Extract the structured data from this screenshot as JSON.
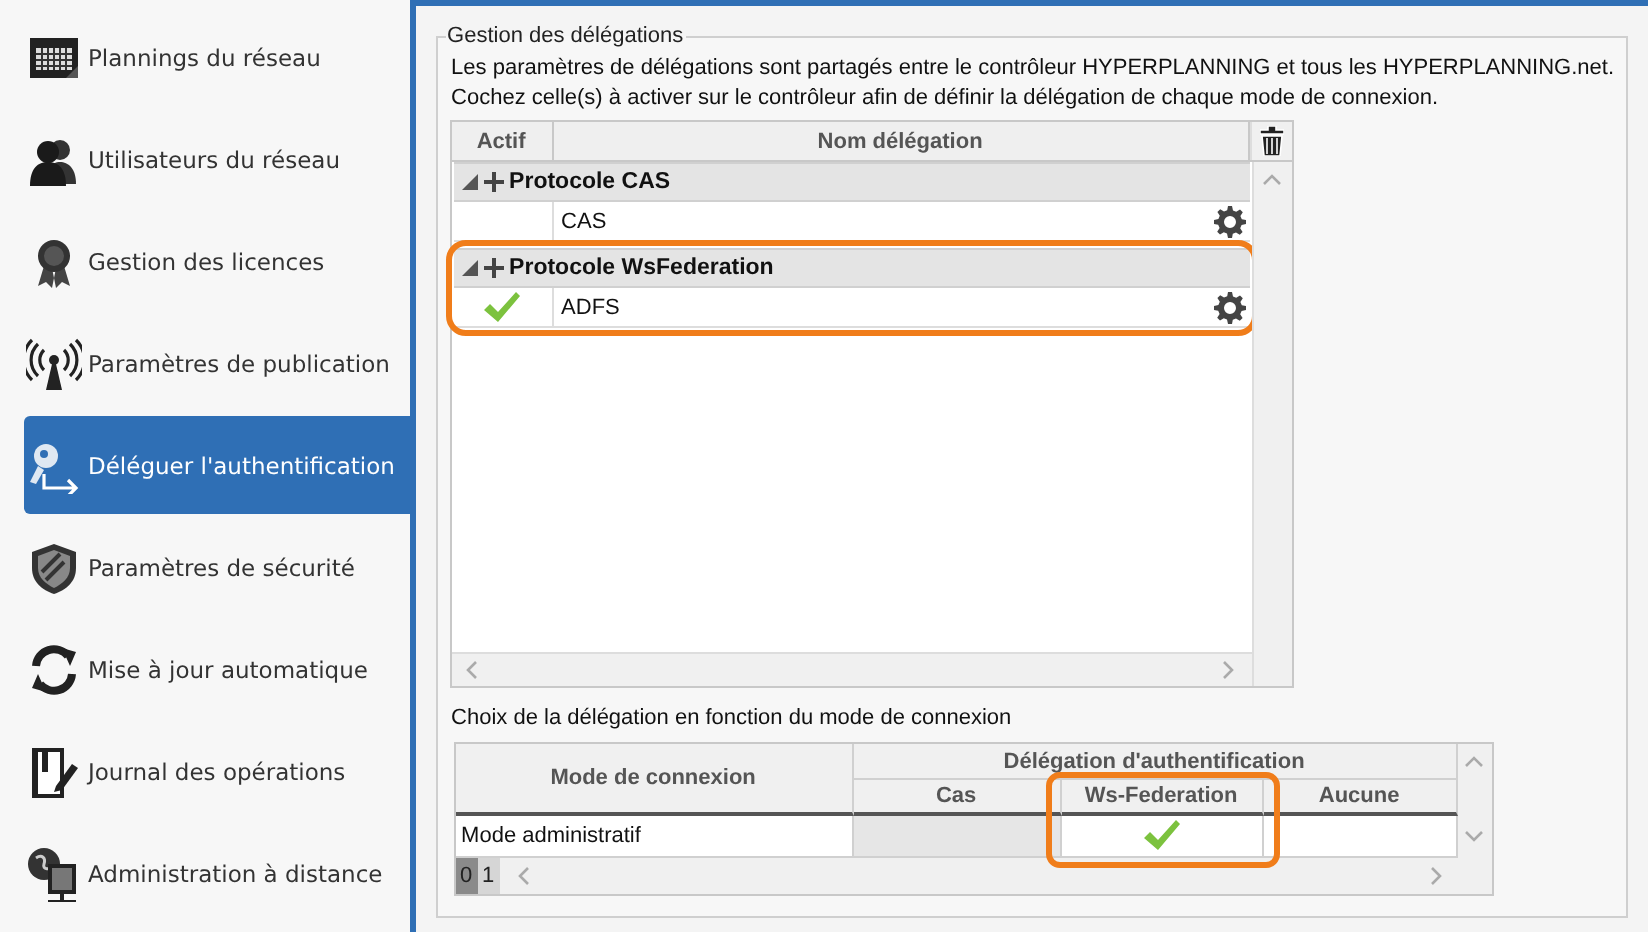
{
  "sidebar": {
    "items": [
      {
        "label": "Plannings du réseau",
        "selected": false
      },
      {
        "label": "Utilisateurs du réseau",
        "selected": false
      },
      {
        "label": "Gestion des licences",
        "selected": false
      },
      {
        "label": "Paramètres de publication",
        "selected": false
      },
      {
        "label": "Déléguer l'authentification",
        "selected": true
      },
      {
        "label": "Paramètres de sécurité",
        "selected": false
      },
      {
        "label": "Mise à jour automatique",
        "selected": false
      },
      {
        "label": "Journal des opérations",
        "selected": false
      },
      {
        "label": "Administration à distance",
        "selected": false
      }
    ]
  },
  "delegations": {
    "title": "Gestion des délégations",
    "description": [
      "Les paramètres de délégations sont partagés entre le contrôleur HYPERPLANNING et tous les HYPERPLANNING.net.",
      "Cochez celle(s) à activer sur le contrôleur afin de définir la délégation de chaque mode de connexion."
    ],
    "columns": [
      "Actif",
      "Nom délégation"
    ],
    "groups": [
      {
        "name": "Protocole CAS",
        "expanded": true,
        "highlighted": false,
        "rows": [
          {
            "name": "CAS",
            "active": false
          }
        ]
      },
      {
        "name": "Protocole WsFederation",
        "expanded": true,
        "highlighted": true,
        "rows": [
          {
            "name": "ADFS",
            "active": true
          }
        ]
      }
    ]
  },
  "connection_modes": {
    "title": "Choix de la délégation en fonction du mode de connexion",
    "mode_column": "Mode de connexion",
    "group_column": "Délégation d'authentification",
    "options": [
      {
        "label": "Cas",
        "highlighted": false
      },
      {
        "label": "Ws-Federation",
        "highlighted": true
      },
      {
        "label": "Aucune",
        "highlighted": false
      }
    ],
    "rows": [
      {
        "mode": "Mode administratif",
        "choices": [
          {
            "selected": false,
            "disabled": true
          },
          {
            "selected": true,
            "disabled": false
          },
          {
            "selected": false,
            "disabled": false
          }
        ]
      }
    ],
    "pages": [
      {
        "label": "0",
        "selected": true
      },
      {
        "label": "1",
        "selected": false
      }
    ]
  }
}
